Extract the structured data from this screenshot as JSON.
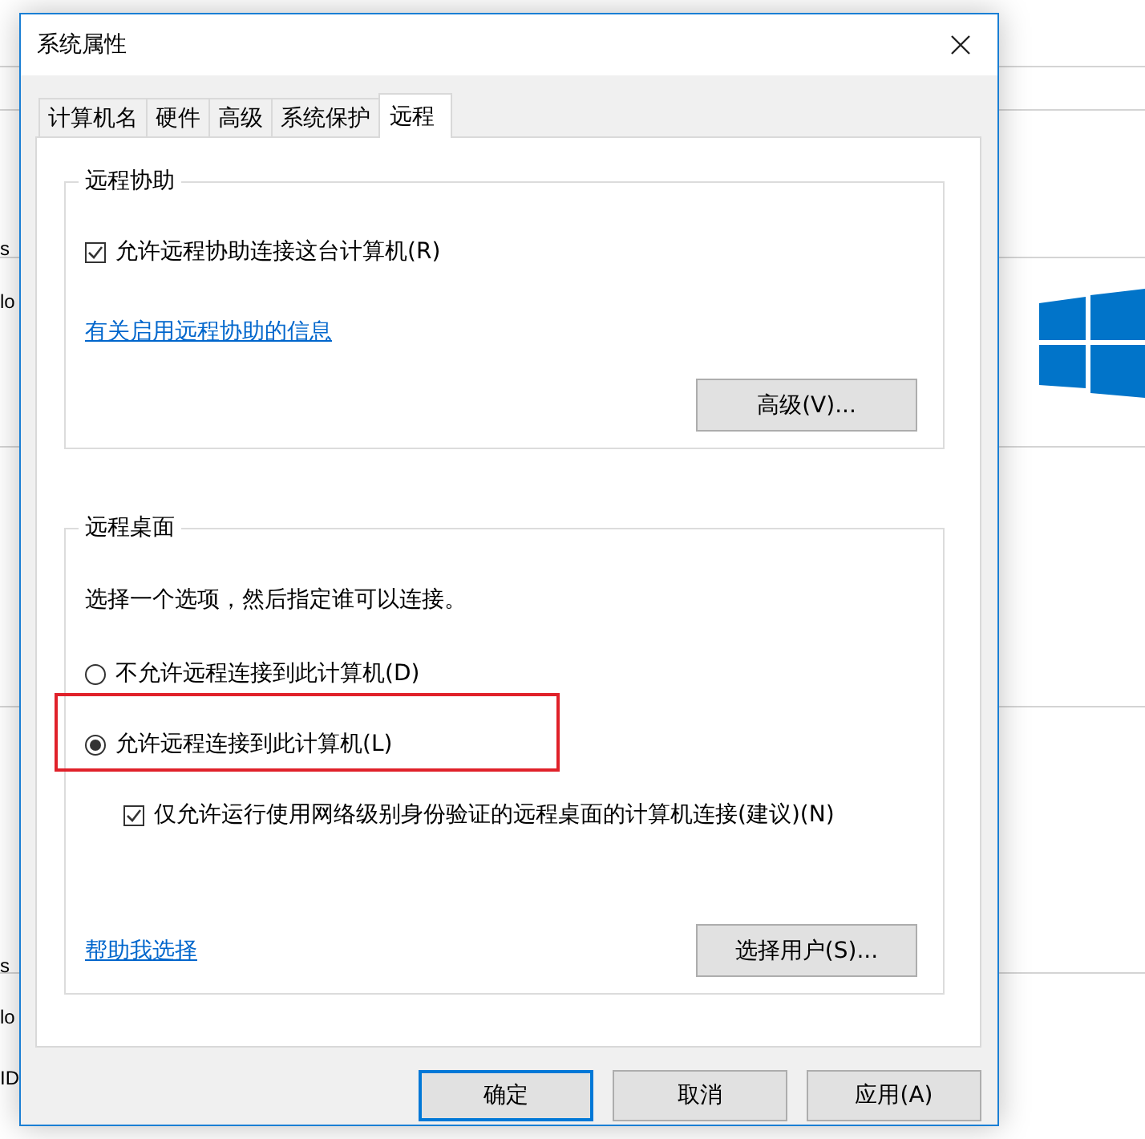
{
  "background": {
    "fragments": [
      "s",
      "lo",
      "s",
      "lo",
      "ID"
    ]
  },
  "dialog": {
    "title": "系统属性"
  },
  "tabs": [
    {
      "label": "计算机名",
      "selected": false
    },
    {
      "label": "硬件",
      "selected": false
    },
    {
      "label": "高级",
      "selected": false
    },
    {
      "label": "系统保护",
      "selected": false
    },
    {
      "label": "远程",
      "selected": true
    }
  ],
  "remote_assistance": {
    "title": "远程协助",
    "checkbox": {
      "label": "允许远程协助连接这台计算机(R)",
      "checked": true
    },
    "link": "有关启用远程协助的信息",
    "button": "高级(V)..."
  },
  "remote_desktop": {
    "title": "远程桌面",
    "instruction": "选择一个选项，然后指定谁可以连接。",
    "options": [
      {
        "label": "不允许远程连接到此计算机(D)",
        "selected": false,
        "highlighted": false
      },
      {
        "label": "允许远程连接到此计算机(L)",
        "selected": true,
        "highlighted": true
      }
    ],
    "nla_checkbox": {
      "label": "仅允许运行使用网络级别身份验证的远程桌面的计算机连接(建议)(N)",
      "checked": true
    },
    "link": "帮助我选择",
    "button": "选择用户(S)..."
  },
  "buttons": [
    {
      "label": "确定",
      "default": true
    },
    {
      "label": "取消",
      "default": false
    },
    {
      "label": "应用(A)",
      "default": false
    }
  ]
}
